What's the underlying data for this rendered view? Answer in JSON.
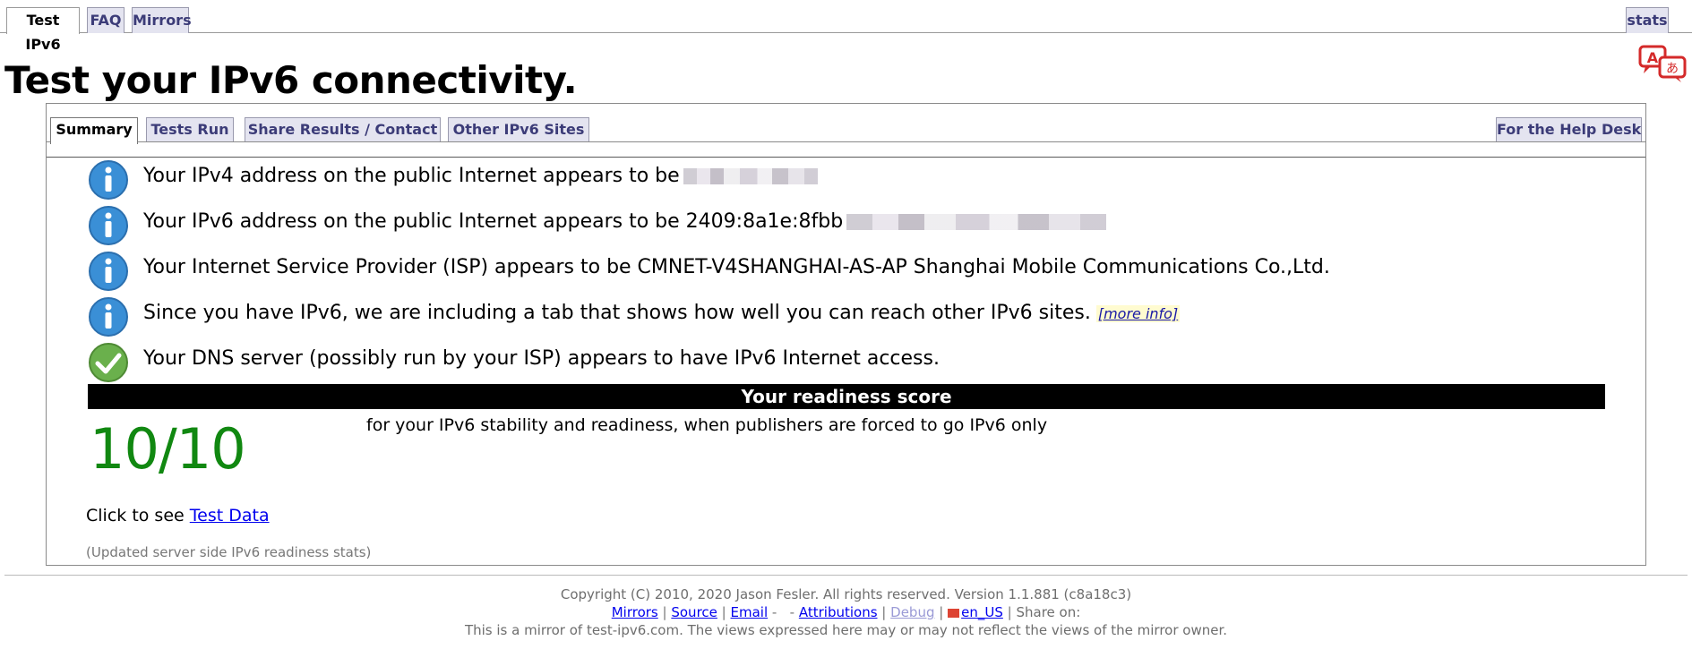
{
  "top_tabs": {
    "test_ipv6": "Test IPv6",
    "faq": "FAQ",
    "mirrors": "Mirrors",
    "stats": "stats"
  },
  "title": "Test your IPv6 connectivity.",
  "sub_tabs": {
    "summary": "Summary",
    "tests_run": "Tests Run",
    "share": "Share Results / Contact",
    "other_sites": "Other IPv6 Sites",
    "help_desk": "For the Help Desk"
  },
  "results": [
    {
      "icon": "info-icon",
      "text": "Your IPv4 address on the public Internet appears to be"
    },
    {
      "icon": "info-icon",
      "text": "Your IPv6 address on the public Internet appears to be 2409:8a1e:8fbb"
    },
    {
      "icon": "info-icon",
      "text": "Your Internet Service Provider (ISP) appears to be CMNET-V4SHANGHAI-AS-AP Shanghai Mobile Communications Co.,Ltd."
    },
    {
      "icon": "info-icon",
      "text": "Since you have IPv6, we are including a tab that shows how well you can reach other IPv6 sites.",
      "link": "[more info]"
    },
    {
      "icon": "check-icon",
      "text": "Your DNS server (possibly run by your ISP) appears to have IPv6 Internet access."
    }
  ],
  "readiness": {
    "header": "Your readiness score",
    "score": "10/10",
    "description": "for your IPv6 stability and readiness, when publishers are forced to go IPv6 only"
  },
  "test_data": {
    "prefix": "Click to see",
    "link": "Test Data"
  },
  "updated_stats": "(Updated server side IPv6 readiness stats)",
  "footer": {
    "copyright": "Copyright (C) 2010, 2020 Jason Fesler. All rights reserved. Version 1.1.881 (c8a18c3)",
    "mirrors": "Mirrors",
    "source": "Source",
    "email": "Email",
    "attributions": "Attributions",
    "debug": "Debug",
    "locale": "en_US",
    "share_on": "Share on:",
    "mirror_note": "This is a mirror of test-ipv6.com. The views expressed here may or may not reflect the views of the mirror owner."
  },
  "colors": {
    "tab_bg": "#e4e4f0",
    "tab_text": "#3c3c78",
    "score_green": "#118811",
    "info_blue": "#3a8fd6",
    "check_green": "#6ab04c",
    "link": "#0000ee"
  }
}
